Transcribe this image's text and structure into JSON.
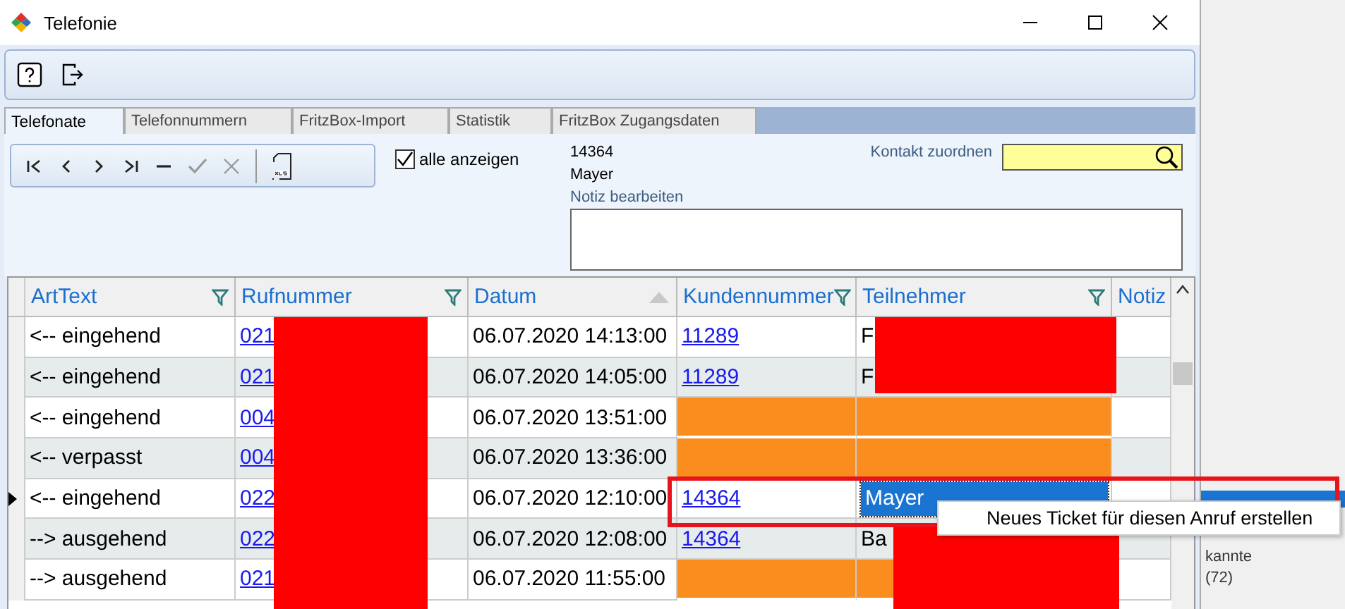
{
  "window": {
    "title": "Telefonie"
  },
  "tabs": [
    {
      "label": "Telefonate",
      "selected": true
    },
    {
      "label": "Telefonnummern",
      "selected": false
    },
    {
      "label": "FritzBox-Import",
      "selected": false
    },
    {
      "label": "Statistik",
      "selected": false
    },
    {
      "label": "FritzBox Zugangsdaten",
      "selected": false
    }
  ],
  "show_all": {
    "label": "alle anzeigen",
    "checked": true
  },
  "contact": {
    "number": "14364",
    "name": "Mayer",
    "note_label": "Notiz bearbeiten",
    "assign_label": "Kontakt zuordnen"
  },
  "table": {
    "columns": [
      {
        "label": "ArtText",
        "filter": true,
        "sort": false
      },
      {
        "label": "Rufnummer",
        "filter": true,
        "sort": false
      },
      {
        "label": "Datum",
        "filter": false,
        "sort": true
      },
      {
        "label": "Kundennummer",
        "filter": true,
        "sort": false
      },
      {
        "label": "Teilnehmer",
        "filter": true,
        "sort": false
      },
      {
        "label": "Notiz",
        "filter": false,
        "sort": false
      }
    ],
    "rows": [
      {
        "type": "<-- eingehend",
        "number": "021",
        "date": "06.07.2020 14:13:00",
        "customer": "11289",
        "participant": "F",
        "unassigned": false,
        "current": false,
        "selected": false
      },
      {
        "type": "<-- eingehend",
        "number": "021",
        "date": "06.07.2020 14:05:00",
        "customer": "11289",
        "participant": "F",
        "unassigned": false,
        "current": false,
        "selected": false
      },
      {
        "type": "<-- eingehend",
        "number": "004",
        "date": "06.07.2020 13:51:00",
        "unassigned": true,
        "current": false,
        "selected": false
      },
      {
        "type": "<-- verpasst",
        "number": "004",
        "date": "06.07.2020 13:36:00",
        "unassigned": true,
        "current": false,
        "selected": false
      },
      {
        "type": "<-- eingehend",
        "number": "022",
        "date": "06.07.2020 12:10:00",
        "customer": "14364",
        "participant": "Mayer",
        "unassigned": false,
        "current": true,
        "selected": true
      },
      {
        "type": "--> ausgehend",
        "number": "022",
        "date": "06.07.2020 12:08:00",
        "customer": "14364",
        "participant": "Ba",
        "unassigned": false,
        "current": false,
        "selected": false
      },
      {
        "type": "--> ausgehend",
        "number": "021",
        "date": "06.07.2020 11:55:00",
        "unassigned": true,
        "current": false,
        "selected": false
      }
    ]
  },
  "context_menu": {
    "items": [
      "Neues Ticket für diesen Anruf erstellen"
    ]
  },
  "background": {
    "texts": [
      "kannte",
      "(72)"
    ]
  }
}
